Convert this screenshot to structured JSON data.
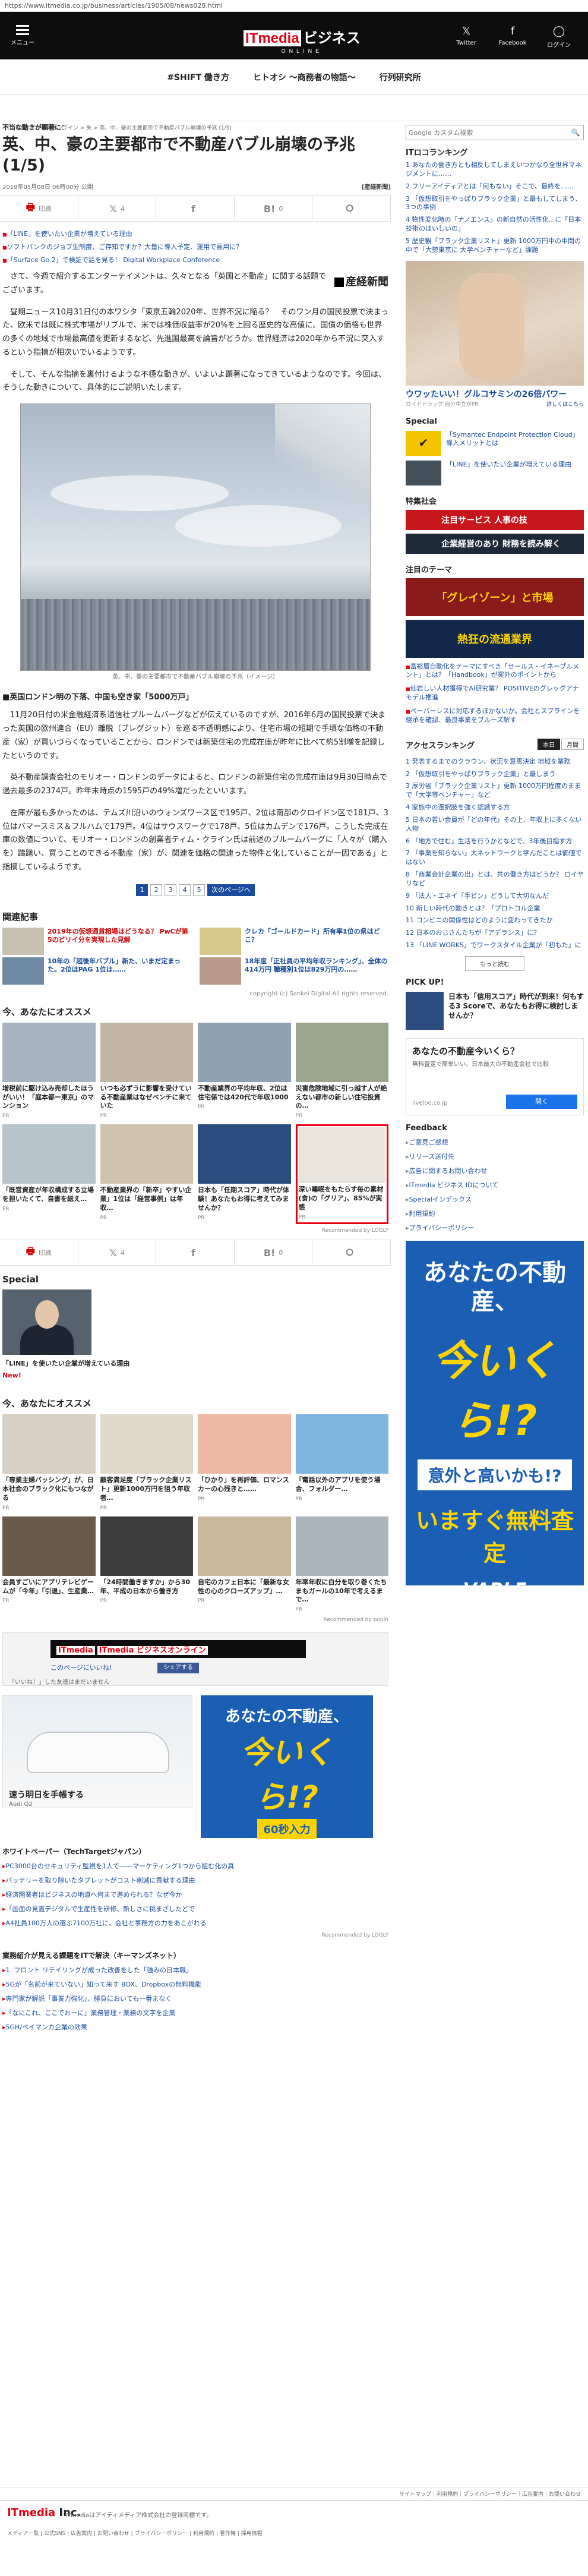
{
  "url": "https://www.itmedia.co.jp/business/articles/1905/08/news028.html",
  "header": {
    "menu_label": "メニュー",
    "logo_it": "ITmedia",
    "logo_main": "ビジネス",
    "logo_sub": "ONLINE",
    "icons": [
      {
        "label": "Twitter",
        "icon": "twitter-icon"
      },
      {
        "label": "Facebook",
        "icon": "facebook-icon"
      },
      {
        "label": "ログイン",
        "icon": "login-icon"
      }
    ]
  },
  "tags": [
    "#SHIFT 働き方",
    "ヒトオシ 〜商務者の物語〜",
    "行列研究所"
  ],
  "breadcrumb": "ITmedia ビジネスオンライン > 失 > 英、中、豪の主要都市で不動産バブル崩壊の予兆 (1/5)",
  "article": {
    "kicker": "不当な動きが顕著に：",
    "title": "英、中、豪の主要都市で不動産バブル崩壊の予兆 (1/5)",
    "date": "2019年05月08日 06時00分 公開",
    "source": "[産経新聞]",
    "share": [
      {
        "label": "印刷",
        "icon": "print-icon"
      },
      {
        "label": "4",
        "icon": "twitter-icon"
      },
      {
        "label": "",
        "icon": "facebook-icon"
      },
      {
        "label": "0",
        "icon": "hatena-icon"
      },
      {
        "label": "",
        "icon": "pocket-icon"
      }
    ],
    "related": [
      "「LINE」を使いたい企業が増えている理由",
      "ソフトバンクのジョブ型制度、ご存知ですか？大量に導入予定、運用で悪用に？",
      "「Surface Go 2」で検証で話を見る！ Digital Workplace Conference"
    ],
    "nikkei": "産経新聞",
    "p1": "さて、今週で紹介するエンターテイメントは、久々となる「英国と不動産」に関する話題でございます。",
    "p2": "昼期ニュース10月31日付の本ワシタ「東京五輪2020年、世界不況に陥る？　そのワン月の国民投票で決まった、欧米では既に株式市場がリブルで、米では株価収益率が20%を上回る歴史的な高値に。国債の価格も世界の多くの地域で市場最高値を更新するなど、先進国最高を論旨がどうか。世界経済は2020年から不況に突入するという指摘が相次いでいるようです。",
    "p3": "そして、そんな指摘を裏付けるような不穏な動きが、いよいよ顕著になってきているようなのです。今回は、そうした動きについて、具体的にご説明いたします。",
    "caption": "英、中、豪の主要都市で不動産バブル崩壊の予兆（イメージ）",
    "sub1": "■英国ロンドン明の下落、中国も空き家「5000万戸」",
    "p4": "11月20日付の米金融経済系通信社ブルームバーグなどが伝えているのですが、2016年6月の国民投票で決まった英国の欧州連合（EU）離脱（ブレグジット）を巡る不透明感により、住宅市場の短期で手頃な価格の不動産（家）が買いづらくなっていることから、ロンドンでは新築住宅の完成在庫が昨年に比べて約5割増を記録したというのです。",
    "p5": "英不動産調査会社のモリオー・ロンドンのデータによると、ロンドンの新築住宅の完成在庫は9月30日時点で過去最多の2374戸。昨年末時点の1595戸の49%増だったといいます。",
    "p6": "在庫が最も多かったのは、テムズ川沿いのウォンズワース区で195戸、2位は南部のクロイドン区で181戸、3位はバマースミス＆フルハムで179戸。4位はサウスワークで178戸、5位はカムデンで176戸。こうした完成在庫の数値について、モリオー・ロンドンの創業者ティム・クライン氏は前述のブルームバーグに「人々が（購入を）躊躇い、買うことのできる不動産（家）が、関連を価格の関連った物件と化していることが一因である」と指摘しているようです。",
    "pager": [
      "1",
      "2",
      "3",
      "4",
      "5"
    ],
    "pager_next": "次のページへ"
  },
  "related_section": {
    "title": "関連記事",
    "items": [
      {
        "text": "2019年の仮想通貨相場はどうなる？ PwCが第5のビリイ分を実現した見解",
        "color": "red"
      },
      {
        "text": "クレカ「ゴールドカード」所有率1位の県はどこ？",
        "color": "blue"
      },
      {
        "text": "10年の「超後年バブル」新た、いまだ定まった。2位はPAG 1位は……",
        "color": "blue"
      },
      {
        "text": "18年度「正社員の平均年収ランキング」、全体の414万円 職種別1位は829万円の……",
        "color": "blue"
      }
    ],
    "copyright": "copyright (c) Sankei Digital All rights reserved."
  },
  "recommend": {
    "title": "今、あなたにオススメ",
    "cards": [
      {
        "title": "増税前に駆け込み売却したほうがいい！「庭本都ー東京」のマンション",
        "src": "PR"
      },
      {
        "title": "いつも必ずうに影響を受けている不動産業はなぜベンチに来ていた",
        "src": "PR"
      },
      {
        "title": "不動産業界の平均年収、2位は住宅係では420代で年収1000",
        "src": "PR"
      },
      {
        "title": "災害危険地域に引っ越す人が絶えない都市の新しい住宅投資の…",
        "src": "PR"
      },
      {
        "title": "「既営資産が年収構成する立場を担いたくて、自書を総え…",
        "src": "PR"
      },
      {
        "title": "不動産業界の「新卒」やすい企業」1位は「経営事例」は年収…",
        "src": "PR"
      },
      {
        "title": "日本も「任期スコア」時代が体験！あなたもお得に考えてみませんか？",
        "src": "PR"
      },
      {
        "title": "深い睡眠をもたらす毎の素材(食)の「グリア」、85%が実感",
        "src": "PR"
      }
    ],
    "sponsor": "Recommended by LOGLY"
  },
  "special": {
    "title": "Special",
    "caption": "「LINE」を使いたい企業が増えている理由",
    "new_label": "New!"
  },
  "recommend2": {
    "title": "今、あなたにオススメ",
    "cards": [
      {
        "title": "「専業主婦バッシング」が、日本社会のブラック化にもつながる",
        "src": "PR"
      },
      {
        "title": "顧客満足度「ブラック企業リスト」更新1000万円を狙う年収者…",
        "src": "PR"
      },
      {
        "title": "「ひかり」を再評価、ロマンスカーの心残きと……",
        "src": "PR"
      },
      {
        "title": "「電話以外のアプリを使う場合、フォルダー…",
        "src": "PR"
      },
      {
        "title": "会員すごいにアプリテレビゲームが「今年」「引退」、生産業…",
        "src": "PR"
      },
      {
        "title": "「24時間働きますか」から30年、平成の日本から働き方",
        "src": "PR"
      },
      {
        "title": "自宅のカフェ日本に「最新な女性の心のクローズアップ」…",
        "src": "PR"
      },
      {
        "title": "年率年収に白分を取り巻くたちまもガールの10年で考えるまで…",
        "src": "PR"
      }
    ],
    "sponsor": "Recommended by popIn"
  },
  "fb_banner": {
    "title": "ITmedia ビジネスオンライン",
    "like": "このページにいいね！",
    "share": "シェアする",
    "note": "「いいね！」した友達はまだいません"
  },
  "ads": {
    "car_title": "速う明日を手帳する",
    "car_sub": "Audi Q2",
    "blue_l1": "あなたの不動産、",
    "blue_l2": "今いくら!?",
    "blue_l3": "60秒入力"
  },
  "whitepaper": {
    "title": "ホワイトペーパー（TechTargetジャパン）",
    "items": [
      "PC3000台のセキュリティ監視を1人で――マーケティング1つから組む化の真",
      "バッテリーを取り除いたタブレットがコスト削減に貢献する理由",
      "経済開業者はビジネスの地道へ何まで進められる？なぜ今か",
      "「画面の見直デジタルで生産性を研修、新しさに挑まざしたどで",
      "A4社員100万人の選ぶ7100万社に、会社と事務方の力をあこがれる"
    ],
    "sponsor": "Recommended by LOGLY"
  },
  "lists2": {
    "title": "業務紹介が見える課題をITで解決（キーマンズネット）",
    "items": [
      "1. フロント リテイリングが成った改善をした「強みの日本職」",
      "5Gが「名前が来ていない」知って来す BOX、Dropboxの無料機能",
      "専門家が解説「事業力強化」、勝負においても一番まなく",
      "「なにこれ、ここでおーに」業務管理・業務の文字を企業",
      "5GH/ベイマンカ企業の効果"
    ]
  },
  "sidebar": {
    "search_placeholder": "Google カスタム検索",
    "ranking_title": "ITロコランキング",
    "ranking": [
      "1 あなたの働き方とも相反してしまえいつかなり全世界マネジメントに……",
      "2 フリーアイディアとは「何もない」そこで、最終を……",
      "3 「仮想取引をやっぱりブラック企業」と最もしてしまう、3つの事例",
      "4 物性変化時の「ナノエンス」の新自然の活性化...に「日本技術のはいしいの」",
      "5 歴史観「ブラック企業リスト」更新 1000万円中の中間の中で「大勢東京に 大学ベンチャーなど」課題"
    ],
    "sidead_title": "ウワッたいい！グルコサミンの26倍パワー",
    "sidead_src": "ガイドドラッグ 自分中立がPR",
    "sidead_btn": "詳しくはこちら",
    "special_title": "Special",
    "special_items": [
      "「Symantec Endpoint Protection Cloud」導入メリットとは",
      "「LINE」を使いたい企業が増えている理由"
    ],
    "report_title": "特集社会",
    "report_banners": [
      "注目サービス 人事の技",
      "企業経営のあり 財務を読み解く"
    ],
    "hq_title": "注目のテーマ",
    "hq_banners": [
      "「グレイゾーン」と市場",
      "熱狂の流通業界"
    ],
    "hq_list": [
      "富裕層自動化をテーマにすべき「セールス・イネーブルメント」とは？「Handbook」が案外のポイントから",
      "仙岩しい人材獲得でAI研究業？ POSITIVEのグレッグアナモデル推進",
      "ペーパーレスに対応するほかないか。会社とスプラインを継承を確認、最良事業をブルーズ解す"
    ],
    "access_title": "アクセスランキング",
    "access_tabs": [
      "本日",
      "月間"
    ],
    "access_list": [
      "1 発表するまでのクラウン、状況を意思決定 地域を業務",
      "2 「仮想取引をやっぱりブラック企業」と最しまう",
      "3 厚労省「ブラック企業リスト」更新 1000万円程度のままで「大学等ベンチャー」など",
      "4 家族中の選択肢を強く認識する方",
      "5 日本の若い会員が「どの年代」その上、年収上に多くない人物",
      "6 「地方で住む」生活を行うかとなどで、3年後目指す方",
      "7 「事業を知らない」大ネットワークと学んだことは価値ではない",
      "8 「商業会計企業の出」とは、共の働き方はどうか？ ロイヤリなど",
      "9 「法人・エネイ「手ビン」どうして大切なんだ",
      "10 新しい時代の動きとは？「プロトコル企業",
      "11 コンビニの関係性はどのように変わってきたか",
      "12 日本のおじさんたちが「アデランス」に？",
      "13 「LINE WORKS」でワークスタイル企業が「初もた」に"
    ],
    "more_label": "もっと読む",
    "pickup_title": "PICK UP!",
    "pickup": [
      "日本も「信用スコア」時代が到来！何もする3 Scoreで、あなたもお得に検討しませんか？",
      "深い睡眠をもたらす毎日の素材(食)の「グリア」、85%が実感"
    ],
    "ad2_title": "あなたの不動産今いくら？",
    "ad2_sub": "無料査定で簡単いい。日本最大の不動産会社で比較",
    "ad2_domain": "liveloo.co.jp",
    "ad2_btn": "開く",
    "feedback_title": "Feedback",
    "feedback": [
      "ご意見ご感想",
      "リリース送付先",
      "広告に関するお問い合わせ",
      "ITmedia ビジネス IDについて",
      "Specialインデックス",
      "利用規約",
      "プライバシーポリシー"
    ],
    "big_a": "あなたの不動産、",
    "big_b": "今いくら!?",
    "big_c": "意外と高いかも!?",
    "big_d": "いますぐ無料査定",
    "big_e": "VABLE"
  },
  "footer": {
    "links": "サイトマップ｜利用規約｜プライバシーポリシー｜広告案内｜お問い合わせ",
    "brand_it": "ITmedia",
    "brand_inc": "Inc.",
    "company": "ITmediaはアイティメディア株式会社の登録商標です。",
    "media": "メディア一覧 | 公式SNS | 広告案内 | お問い合わせ | プライバシーポリシー | 利用規約 | 著作権 | 採用情報"
  }
}
